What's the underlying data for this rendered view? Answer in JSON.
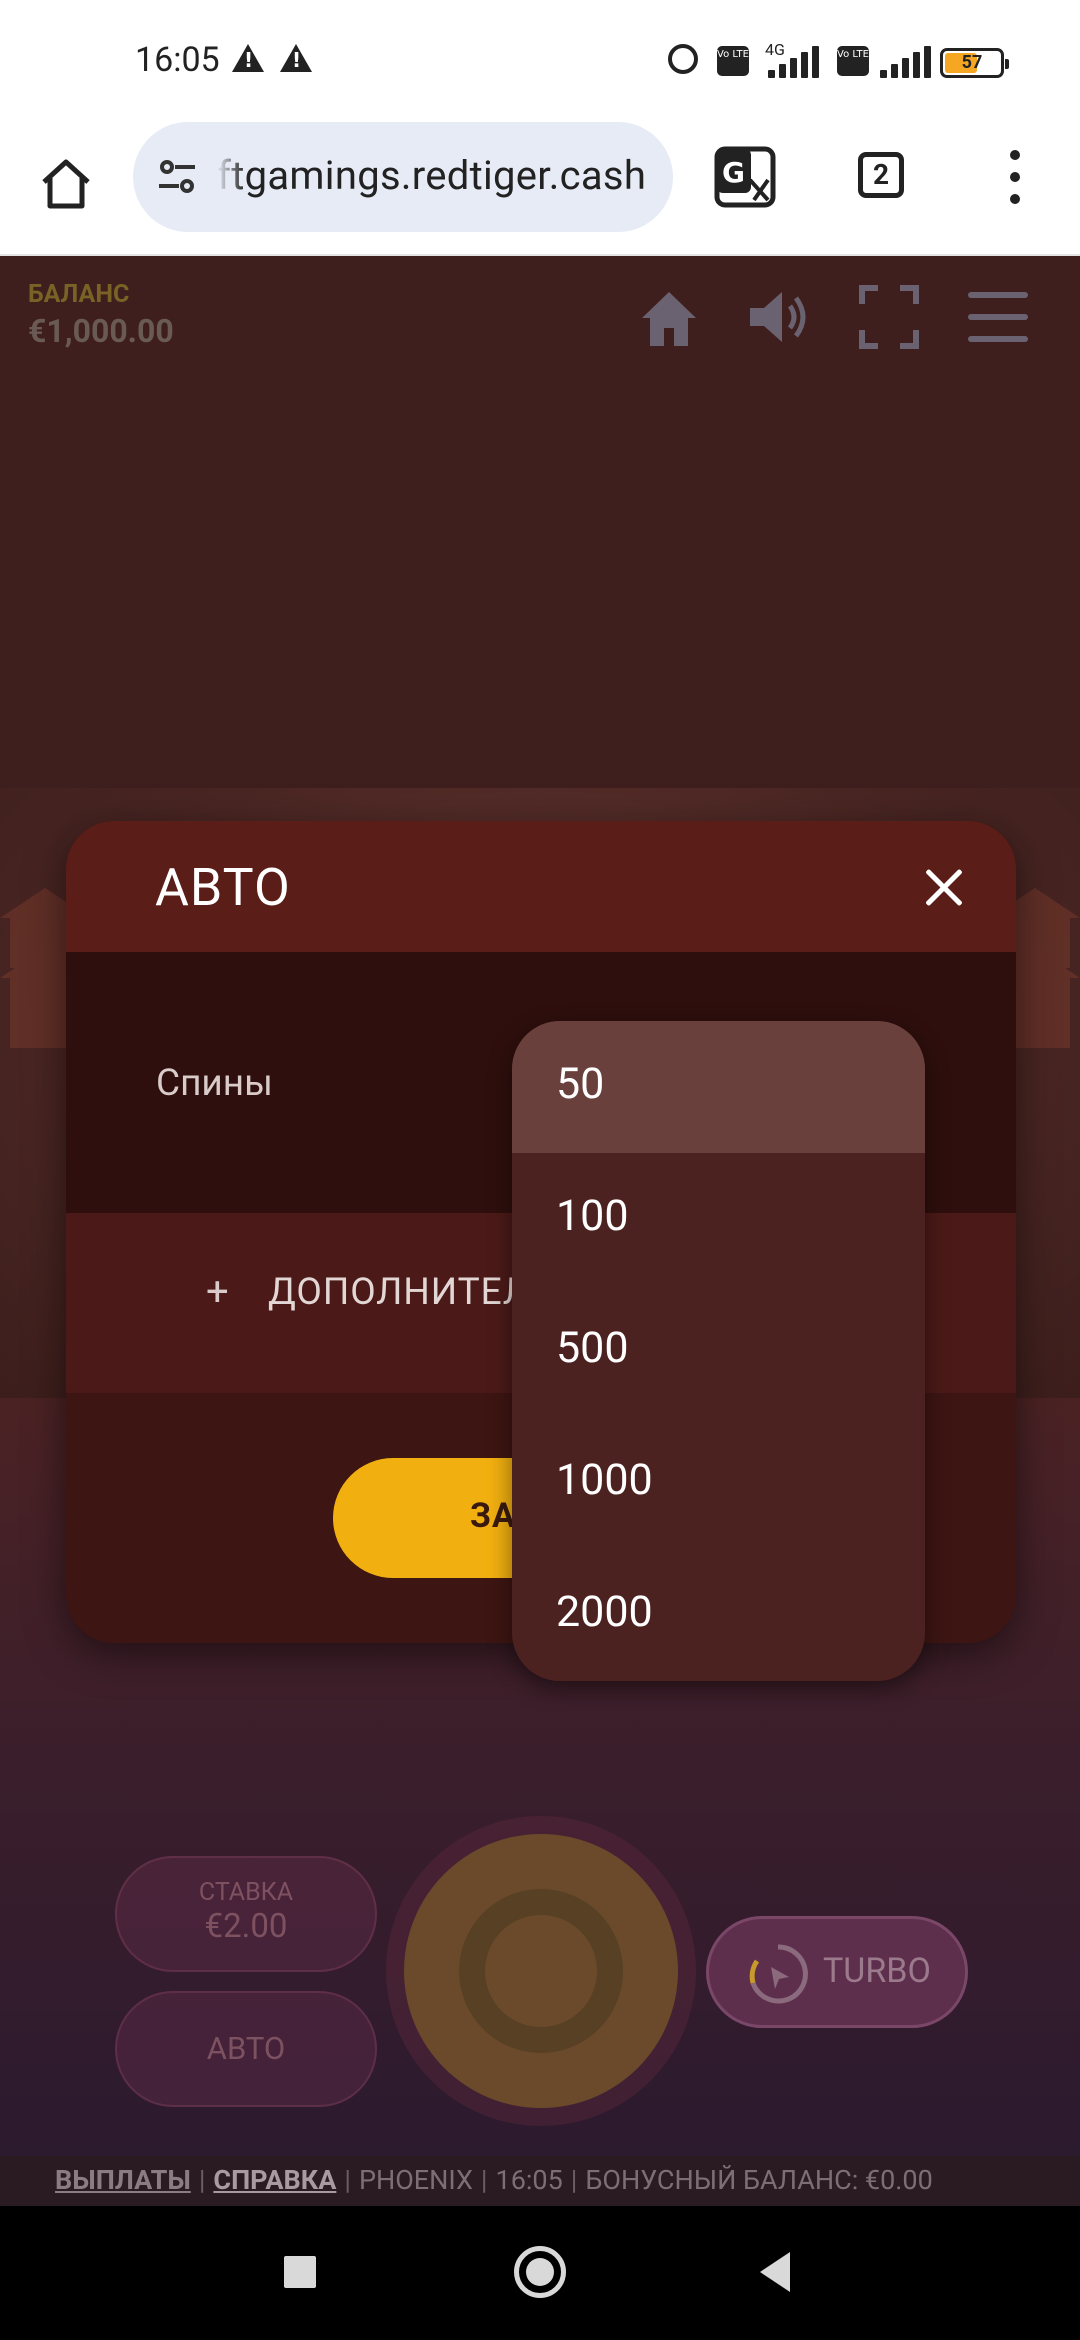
{
  "status_bar": {
    "time": "16:05",
    "net": "4G",
    "volte": "Vo LTE",
    "battery": "57"
  },
  "browser": {
    "url": "ftgamings.redtiger.cash",
    "tab_count": "2"
  },
  "game": {
    "balance_label": "БАЛАНС",
    "balance_value": "€1,000.00",
    "stake_label": "СТАВКА",
    "stake_value": "€2.00",
    "auto_label": "АВТО",
    "turbo_label": "TURBO"
  },
  "modal": {
    "title": "АВТО",
    "spins_label": "Спины",
    "advanced_label": "ДОПОЛНИТЕЛ",
    "advanced_plus": "+",
    "start_label": "ЗА"
  },
  "dropdown": {
    "options": [
      "50",
      "100",
      "500",
      "1000",
      "2000"
    ],
    "selected": "50"
  },
  "footer": {
    "payouts": "ВЫПЛАТЫ",
    "help": "СПРАВКА",
    "game_name": "PHOENIX",
    "time": "16:05",
    "bonus": "БОНУСНЫЙ БАЛАНС: €0.00"
  },
  "colors": {
    "accent_yellow": "#f2b010",
    "modal_bg": "#3d1512",
    "dropdown_bg": "#4c2221"
  }
}
